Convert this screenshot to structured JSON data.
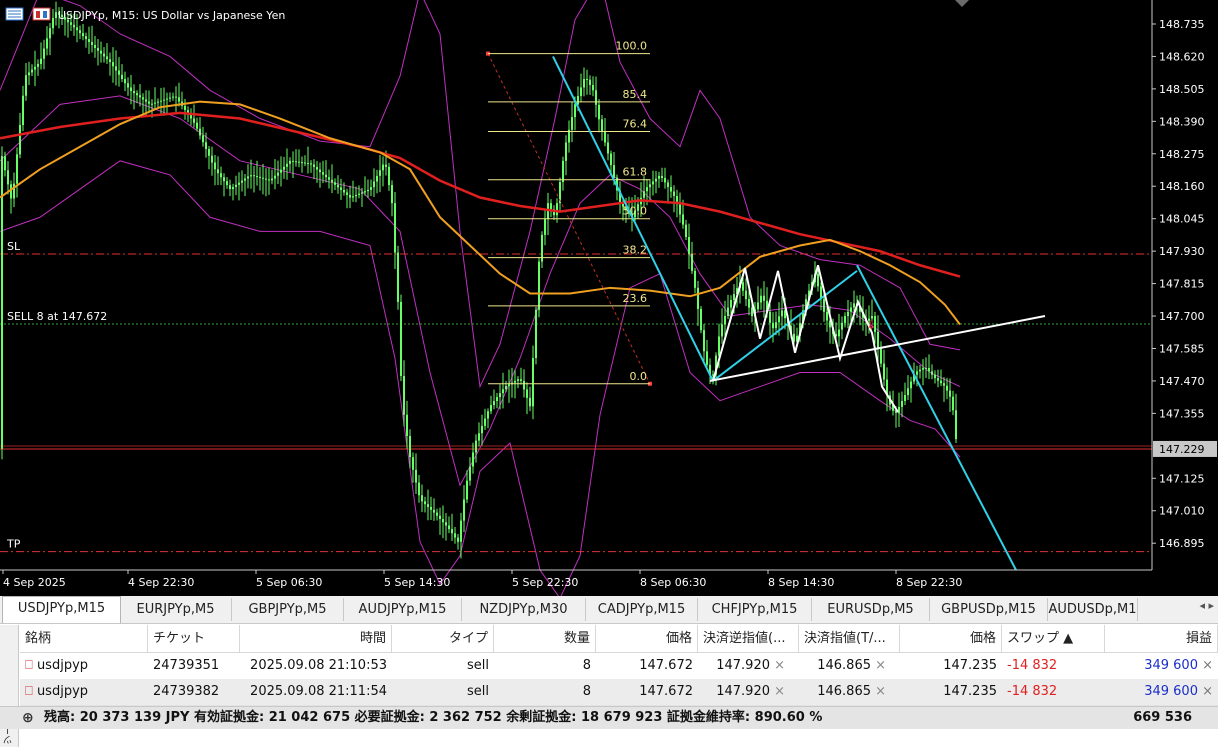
{
  "window": {
    "chart_title": "USDJPYp, M15:  US Dollar vs Japanese Yen"
  },
  "chart_data": {
    "type": "line",
    "title": "USDJPYp, M15:  US Dollar vs Japanese Yen",
    "price_axis_ticks": [
      "148.735",
      "148.620",
      "148.505",
      "148.390",
      "148.275",
      "148.160",
      "148.045",
      "147.930",
      "147.815",
      "147.700",
      "147.585",
      "147.470",
      "147.355",
      "147.229",
      "147.125",
      "147.010",
      "146.895"
    ],
    "current_price": "147.229",
    "time_axis_ticks": [
      "4 Sep 2025",
      "4 Sep 22:30",
      "5 Sep 06:30",
      "5 Sep 14:30",
      "5 Sep 22:30",
      "8 Sep 06:30",
      "8 Sep 14:30",
      "8 Sep 22:30"
    ],
    "ylim": [
      146.8,
      148.82
    ],
    "level_lines": [
      {
        "label": "SL",
        "price": 147.92
      },
      {
        "label": "SELL 8 at 147.672",
        "price": 147.672
      },
      {
        "label": "TP",
        "price": 146.865
      }
    ],
    "fibonacci_levels": [
      "100.0",
      "85.4",
      "76.4",
      "61.8",
      "50.0",
      "38.2",
      "23.6",
      "0.0"
    ],
    "colors": {
      "background": "#000000",
      "candles": "#66ff66",
      "ma_red": "#e0201e",
      "ma_orange": "#f0a020",
      "bollinger": "#c030c0",
      "trend_cyan": "#30d0e8",
      "trend_white": "#ffffff",
      "sl_tp": "#e03030",
      "sell_line": "#3aa03a",
      "price_line": "#e03030"
    }
  },
  "tabs": [
    "USDJPYp,M15",
    "EURJPYp,M5",
    "GBPJPYp,M5",
    "AUDJPYp,M15",
    "NZDJPYp,M30",
    "CADJPYp,M15",
    "CHFJPYp,M15",
    "EURUSDp,M5",
    "GBPUSDp,M15",
    "AUDUSDp,M1"
  ],
  "tab_arrows": "◂ ▸",
  "table": {
    "headers": [
      "銘柄",
      "チケット",
      "時間",
      "タイプ",
      "数量",
      "価格",
      "決済逆指値(...",
      "決済指値(T/...",
      "価格",
      "スワップ",
      "損益"
    ],
    "sort_indicator": "▲",
    "rows": [
      {
        "symbol": "usdjpyp",
        "ticket": "24739351",
        "time": "2025.09.08 21:10:53",
        "type": "sell",
        "volume": "8",
        "open_price": "147.672",
        "sl": "147.920",
        "tp": "146.865",
        "price": "147.235",
        "swap": "-14 832",
        "profit": "349 600"
      },
      {
        "symbol": "usdjpyp",
        "ticket": "24739382",
        "time": "2025.09.08 21:11:54",
        "type": "sell",
        "volume": "8",
        "open_price": "147.672",
        "sl": "147.920",
        "tp": "146.865",
        "price": "147.235",
        "swap": "-14 832",
        "profit": "349 600"
      }
    ],
    "close_glyph": "×"
  },
  "summary": {
    "text": "残高: 20 373 139 JPY  有効証拠金: 21 042 675  必要証拠金: 2 362 752  余剰証拠金: 18 679 923  証拠金維持率: 890.60 %",
    "total": "669 536"
  },
  "sidebar_label": "ツールボックス"
}
